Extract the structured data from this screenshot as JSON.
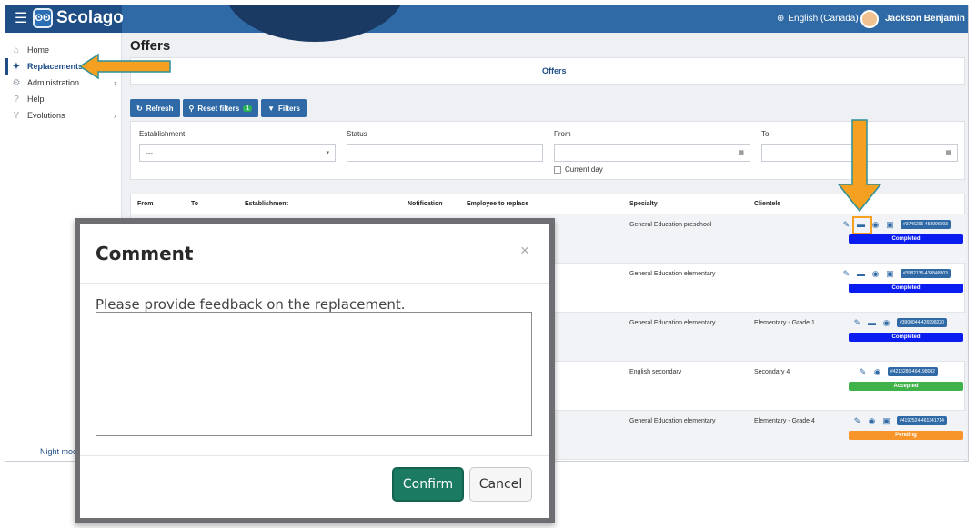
{
  "header": {
    "app_name": "Scolago",
    "language": "English (Canada)",
    "user_name": "Jackson Benjamin"
  },
  "sidebar": {
    "items": [
      {
        "label": "Home",
        "icon": "home-icon"
      },
      {
        "label": "Replacements",
        "icon": "handshake-icon",
        "active": true
      },
      {
        "label": "Administration",
        "icon": "gear-icon",
        "has_children": true
      },
      {
        "label": "Help",
        "icon": "question-icon"
      },
      {
        "label": "Evolutions",
        "icon": "filter-icon",
        "has_children": true
      }
    ],
    "night_mode_label": "Night mod"
  },
  "main": {
    "title": "Offers",
    "tab_label": "Offers",
    "buttons": {
      "refresh": "Refresh",
      "reset_filters": "Reset filters",
      "reset_filters_count": "1",
      "filters": "Filters"
    },
    "filters": {
      "establishment_label": "Establishment",
      "establishment_value": "---",
      "status_label": "Status",
      "from_label": "From",
      "to_label": "To",
      "current_day_label": "Current day"
    },
    "table": {
      "headers": [
        "From",
        "To",
        "Establishment",
        "Notification",
        "Employee to replace",
        "Specialty",
        "Clientele"
      ],
      "rows": [
        {
          "specialty": "General Education preschool",
          "clientele": "",
          "id": "#3746296-458996993",
          "status": "Completed",
          "status_color": "#0a1df0"
        },
        {
          "specialty": "General Education elementary",
          "clientele": "",
          "id": "#3982135-438848803",
          "status": "Completed",
          "status_color": "#0a1df0"
        },
        {
          "specialty": "General Education elementary",
          "clientele": "Elementary - Grade 1",
          "id": "#3900044-426998220",
          "status": "Completed",
          "status_color": "#0a1df0"
        },
        {
          "specialty": "English secondary",
          "clientele": "Secondary 4",
          "id": "#4216280-464198082",
          "status": "Accepted",
          "status_color": "#3fb24a"
        },
        {
          "specialty": "General Education elementary",
          "clientele": "Elementary - Grade 4",
          "id": "#4192524-461341714",
          "status": "Pending",
          "status_color": "#f7942a"
        }
      ]
    }
  },
  "modal": {
    "title": "Comment",
    "close": "×",
    "prompt": "Please provide feedback on the replacement.",
    "confirm": "Confirm",
    "cancel": "Cancel"
  },
  "colors": {
    "accent": "#2f6aa6",
    "arrow": "#f5a021",
    "confirm": "#1a7a62"
  }
}
